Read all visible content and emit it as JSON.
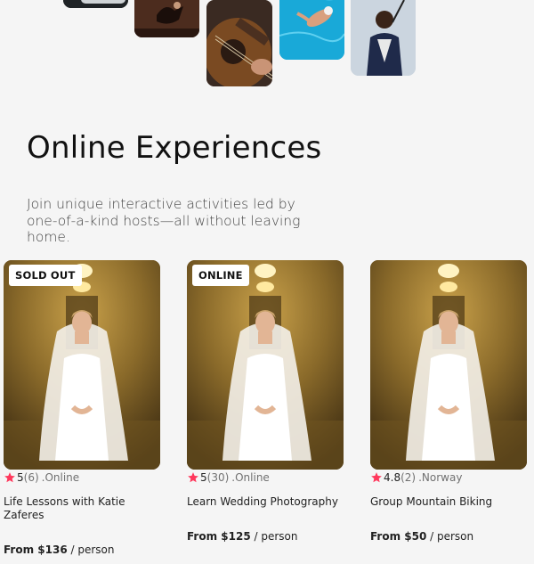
{
  "section": {
    "title": "Online Experiences",
    "intro": "Join unique interactive activities led by one-of-a-kind hosts—all without leaving home."
  },
  "colors": {
    "background": "#f5f5f5",
    "star": "#ff385c",
    "muted_text": "#717171"
  },
  "cards": [
    {
      "badge": "SOLD OUT",
      "rating": "5",
      "reviews": "(6)",
      "location": ".Online",
      "title": "Life Lessons with Katie Zaferes",
      "price": "From $136",
      "price_unit": " / person"
    },
    {
      "badge": "ONLINE",
      "rating": "5",
      "reviews": "(30)",
      "location": ".Online",
      "title": "Learn Wedding Photography",
      "price": "From $125",
      "price_unit": " / person"
    },
    {
      "badge": "",
      "rating": "4.8",
      "reviews": "(2)",
      "location": ".Norway",
      "title": "Group Mountain Biking",
      "price": "From $50",
      "price_unit": " / person"
    }
  ]
}
